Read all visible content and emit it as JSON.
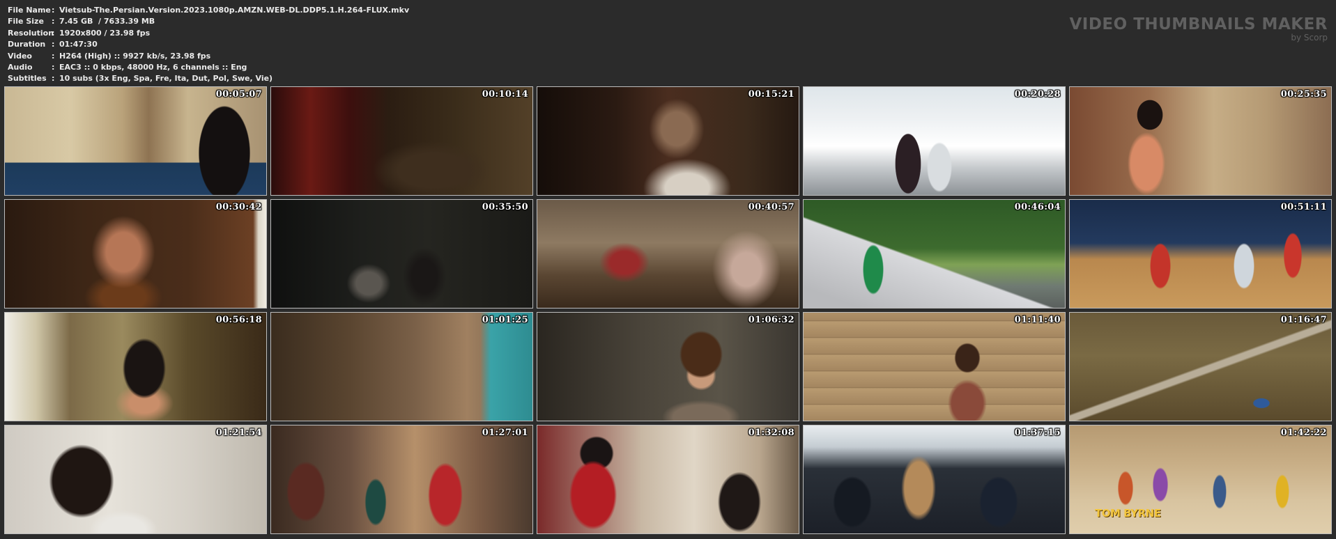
{
  "info": {
    "rows": [
      {
        "label": "File Name",
        "value": "Vietsub-The.Persian.Version.2023.1080p.AMZN.WEB-DL.DDP5.1.H.264-FLUX.mkv"
      },
      {
        "label": "File Size",
        "value": "7.45 GB  / 7633.39 MB"
      },
      {
        "label": "Resolution",
        "value": "1920x800 / 23.98 fps"
      },
      {
        "label": "Duration",
        "value": "01:47:30"
      },
      {
        "label": "Video",
        "value": "H264 (High) :: 9927 kb/s, 23.98 fps"
      },
      {
        "label": "Audio",
        "value": "EAC3 :: 0 kbps, 48000 Hz, 6 channels :: Eng"
      },
      {
        "label": "Subtitles",
        "value": "10 subs (3x Eng, Spa, Fre, Ita, Dut, Pol, Swe, Vie)"
      }
    ],
    "separator": ":"
  },
  "brand": {
    "title": "VIDEO THUMBNAILS MAKER",
    "subtitle": "by Scorp"
  },
  "thumbnails": [
    {
      "time": "00:05:07"
    },
    {
      "time": "00:10:14"
    },
    {
      "time": "00:15:21"
    },
    {
      "time": "00:20:28"
    },
    {
      "time": "00:25:35"
    },
    {
      "time": "00:30:42"
    },
    {
      "time": "00:35:50"
    },
    {
      "time": "00:40:57"
    },
    {
      "time": "00:46:04"
    },
    {
      "time": "00:51:11"
    },
    {
      "time": "00:56:18"
    },
    {
      "time": "01:01:25"
    },
    {
      "time": "01:06:32"
    },
    {
      "time": "01:11:40"
    },
    {
      "time": "01:16:47"
    },
    {
      "time": "01:21:54"
    },
    {
      "time": "01:27:01"
    },
    {
      "time": "01:32:08"
    },
    {
      "time": "01:37:15"
    },
    {
      "time": "01:42:22"
    }
  ],
  "overlay_logo": "TOM BYRNE"
}
